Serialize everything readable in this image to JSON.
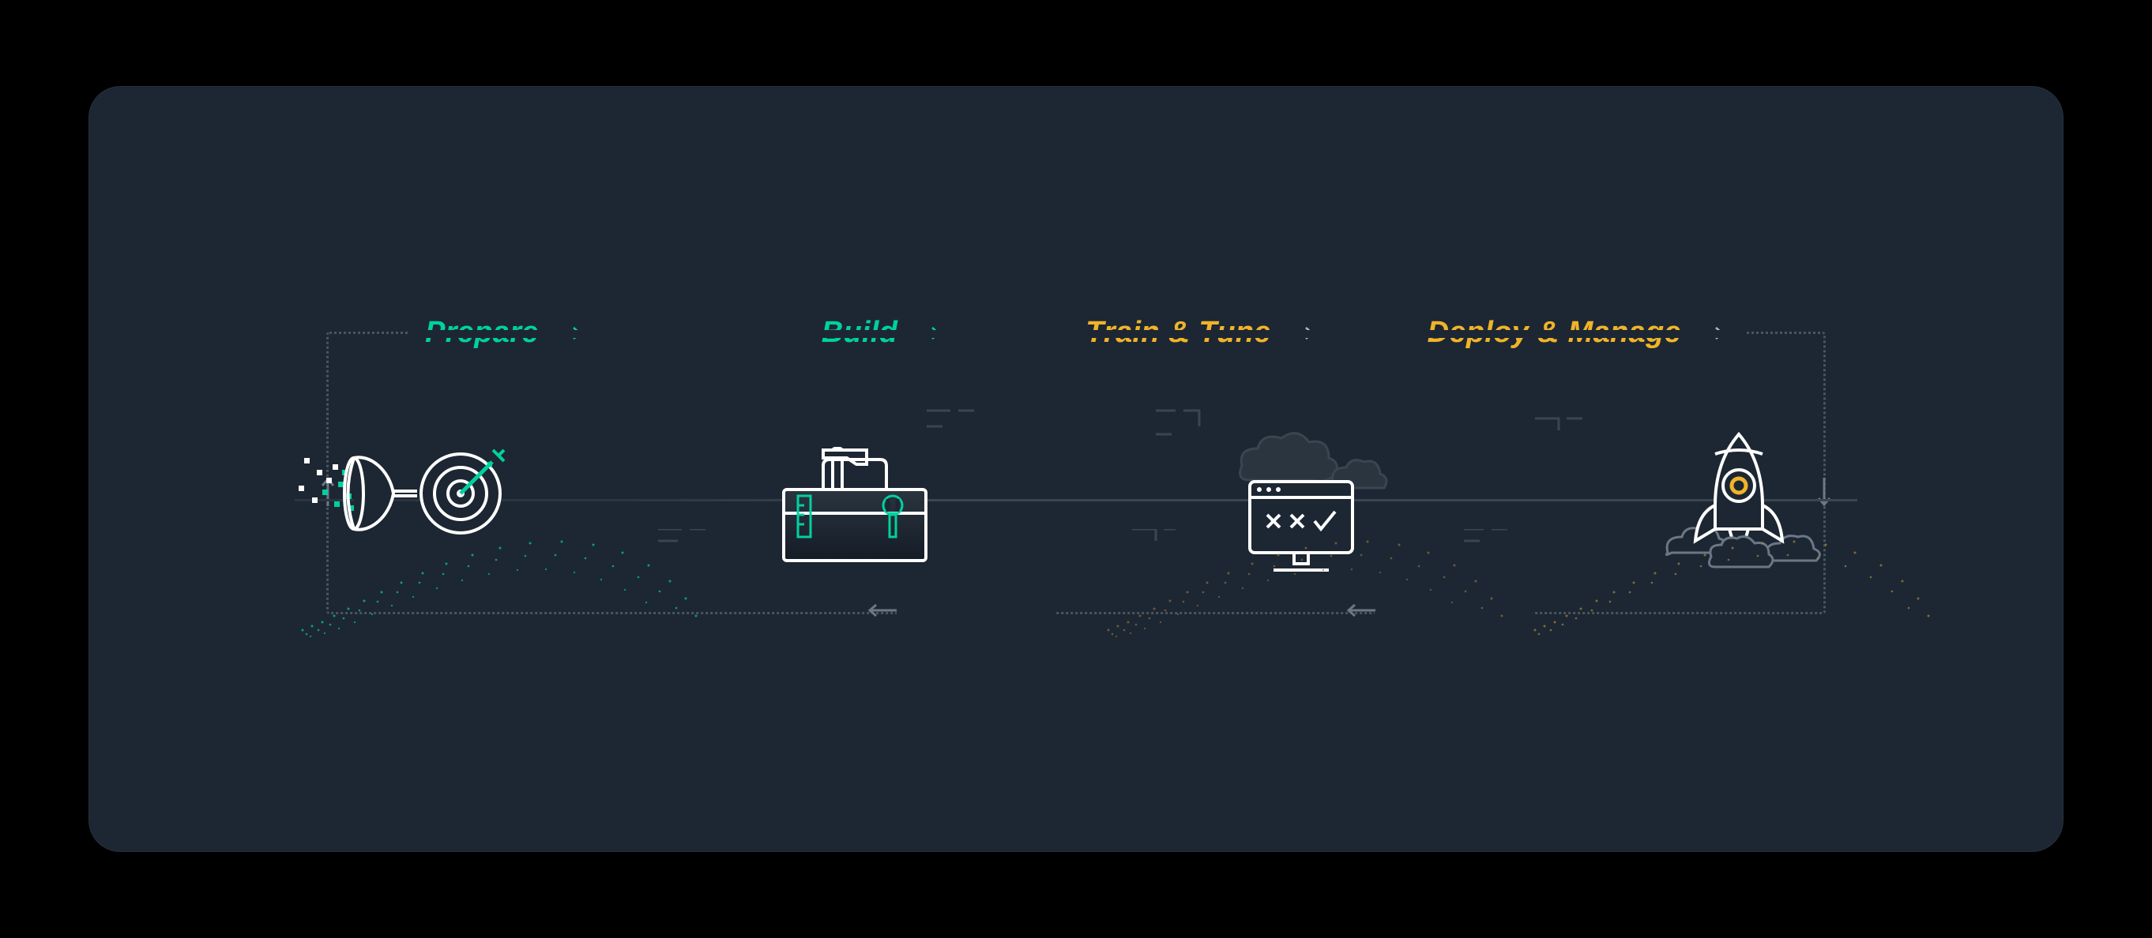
{
  "stages": [
    {
      "id": "prepare",
      "label": "Prepare",
      "color": "#00d19e"
    },
    {
      "id": "build",
      "label": "Build",
      "color": "#00d19e"
    },
    {
      "id": "train",
      "label": "Train & Tune",
      "color": "#f0b429"
    },
    {
      "id": "deploy",
      "label": "Deploy & Manage",
      "color": "#f0b429"
    }
  ],
  "icons": {
    "prepare": "funnel-target-icon",
    "build": "toolbox-icon",
    "train": "cloud-monitor-icon",
    "deploy": "rocket-icon"
  }
}
